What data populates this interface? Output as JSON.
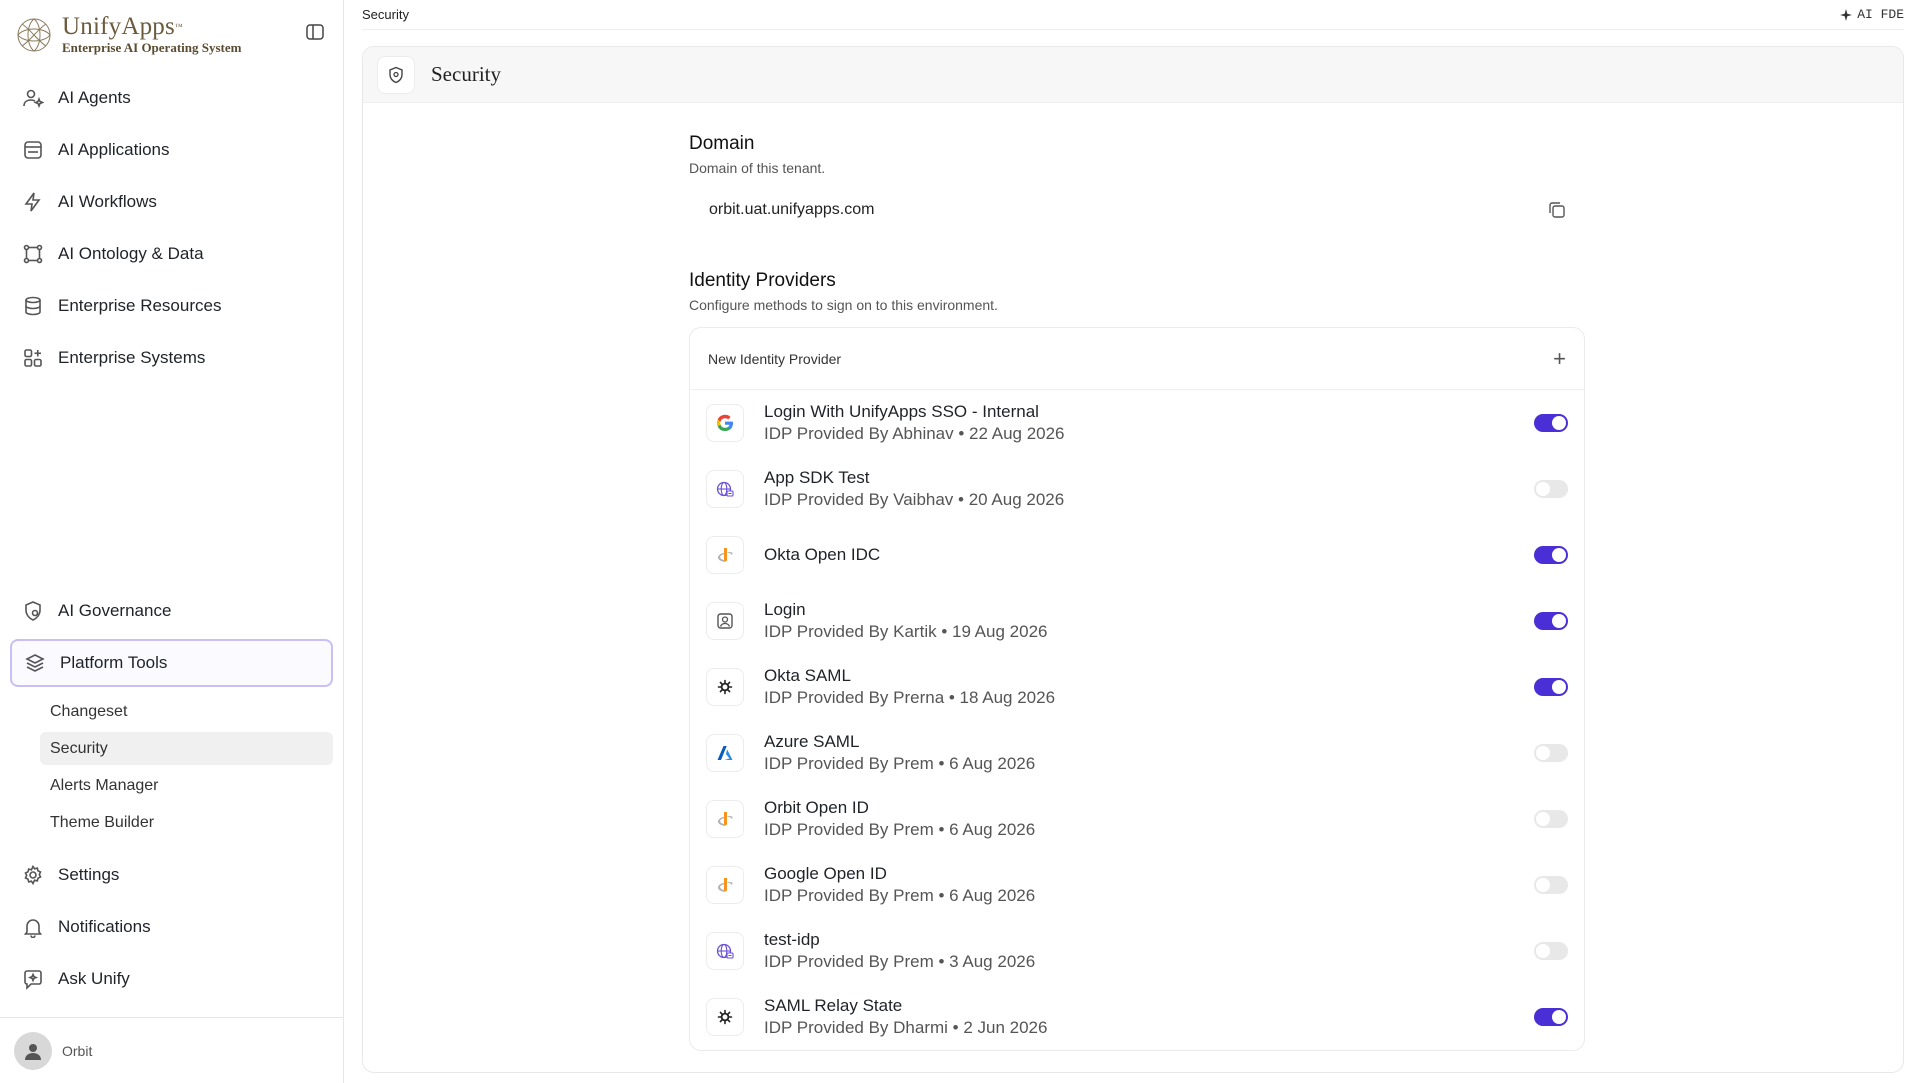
{
  "brand": {
    "name": "UnifyApps",
    "tm": "™",
    "subtitle": "Enterprise AI Operating System"
  },
  "sidebar": {
    "items": [
      {
        "label": "AI Agents",
        "icon": "user-sparkle-icon"
      },
      {
        "label": "AI Applications",
        "icon": "app-window-icon"
      },
      {
        "label": "AI Workflows",
        "icon": "lightning-icon"
      },
      {
        "label": "AI Ontology & Data",
        "icon": "graph-nodes-icon"
      },
      {
        "label": "Enterprise Resources",
        "icon": "database-icon"
      },
      {
        "label": "Enterprise Systems",
        "icon": "grid-plus-icon"
      }
    ],
    "governance": "AI Governance",
    "platform_tools": "Platform Tools",
    "sub_items": [
      "Changeset",
      "Security",
      "Alerts Manager",
      "Theme Builder"
    ],
    "settings": "Settings",
    "notifications": "Notifications",
    "ask": "Ask Unify",
    "user": "Orbit"
  },
  "header": {
    "breadcrumb": "Security",
    "ai_fde": "AI FDE"
  },
  "panel": {
    "title": "Security"
  },
  "domain": {
    "title": "Domain",
    "desc": "Domain of this tenant.",
    "value": "orbit.uat.unifyapps.com"
  },
  "identity": {
    "title": "Identity Providers",
    "desc": "Configure methods to sign on to this environment.",
    "new_label": "New Identity Provider",
    "providers": [
      {
        "name": "Login With UnifyApps SSO - Internal",
        "meta": "IDP Provided By Abhinav • 22 Aug 2026",
        "icon": "google-icon",
        "enabled": true
      },
      {
        "name": "App SDK Test",
        "meta": "IDP Provided By Vaibhav • 20 Aug 2026",
        "icon": "globe-icon",
        "enabled": false
      },
      {
        "name": "Okta Open IDC",
        "meta": "",
        "icon": "openid-icon",
        "enabled": true
      },
      {
        "name": "Login",
        "meta": "IDP Provided By Kartik • 19 Aug 2026",
        "icon": "user-badge-icon",
        "enabled": true
      },
      {
        "name": "Okta SAML",
        "meta": "IDP Provided By Prerna • 18 Aug 2026",
        "icon": "okta-icon",
        "enabled": true
      },
      {
        "name": "Azure SAML",
        "meta": "IDP Provided By Prem • 6 Aug 2026",
        "icon": "azure-icon",
        "enabled": false
      },
      {
        "name": "Orbit Open ID",
        "meta": "IDP Provided By Prem • 6 Aug 2026",
        "icon": "openid-icon",
        "enabled": false
      },
      {
        "name": "Google Open ID",
        "meta": "IDP Provided By Prem • 6 Aug 2026",
        "icon": "openid-icon",
        "enabled": false
      },
      {
        "name": "test-idp",
        "meta": "IDP Provided By Prem • 3 Aug 2026",
        "icon": "globe-icon",
        "enabled": false
      },
      {
        "name": "SAML Relay State",
        "meta": "IDP Provided By Dharmi • 2 Jun 2026",
        "icon": "okta-icon",
        "enabled": true
      }
    ]
  },
  "colors": {
    "accent": "#4a2fd6",
    "active_border": "#c7bff5"
  }
}
